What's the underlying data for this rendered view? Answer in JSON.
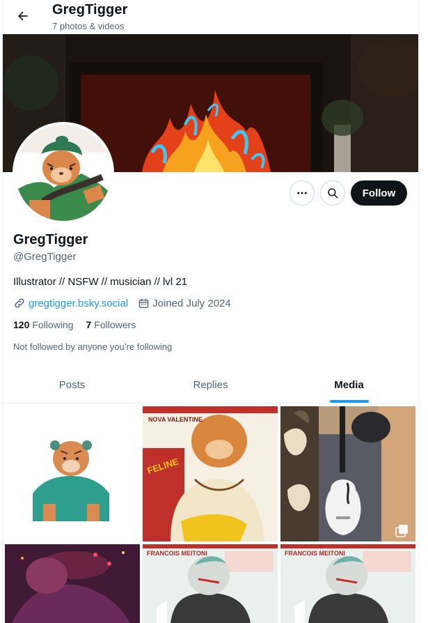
{
  "header": {
    "title": "GregTigger",
    "subtitle": "7 photos & videos"
  },
  "profile": {
    "display_name": "GregTigger",
    "handle": "@GregTigger",
    "bio": "Illustrator // NSFW // musician // lvl 21",
    "website": "gregtigger.bsky.social",
    "joined": "Joined July 2024",
    "following_count": "120",
    "following_label": "Following",
    "followers_count": "7",
    "followers_label": "Followers",
    "not_followed_note": "Not followed by anyone you’re following"
  },
  "actions": {
    "follow_label": "Follow"
  },
  "tabs": [
    {
      "label": "Posts",
      "active": false
    },
    {
      "label": "Replies",
      "active": false
    },
    {
      "label": "Media",
      "active": true
    }
  ],
  "media_poster_text": {
    "tile2_name": "NOVA VALENTINE",
    "tile2_feline": "FELINE",
    "tile5_name": "FRANCOIS MEITONI",
    "tile6_name": "FRANCOIS MEITONI"
  },
  "icons": {
    "back": "arrow-left-icon",
    "more": "more-horizontal-icon",
    "search": "search-icon",
    "link": "link-icon",
    "calendar": "calendar-icon",
    "multi_photo": "multiple-photos-icon"
  },
  "colors": {
    "accent": "#1d9bf0",
    "text_primary": "#0f1419",
    "text_secondary": "#536471",
    "follow_bg": "#0f1419"
  }
}
